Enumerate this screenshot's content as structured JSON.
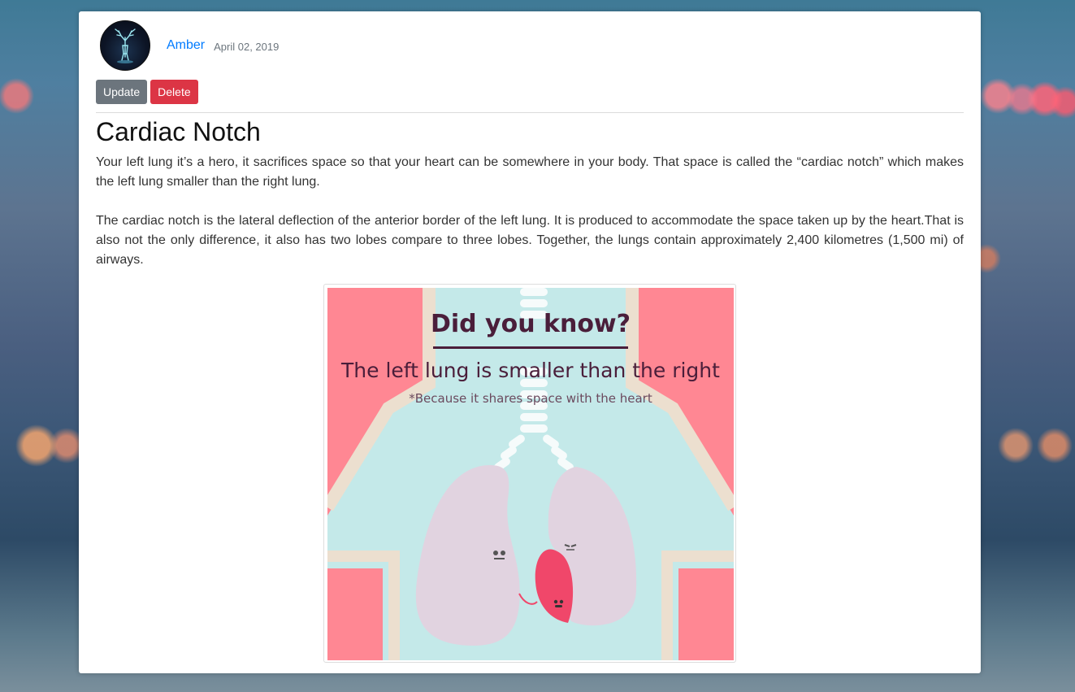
{
  "post": {
    "author": "Amber",
    "date": "April 02, 2019",
    "title": "Cardiac Notch",
    "paragraphs": [
      "Your left lung it’s a hero, it sacrifices space so that your heart can be somewhere in your body. That space is called the “cardiac notch” which makes the left lung smaller than the right lung.",
      "The cardiac notch is the lateral deflection of the anterior border of the left lung. It is produced to accommodate the space taken up by the heart.That is also not the only difference, it also has two lobes compare to three lobes. Together, the lungs contain approximately 2,400 kilometres (1,500 mi) of airways."
    ]
  },
  "actions": {
    "update_label": "Update",
    "delete_label": "Delete"
  },
  "illustration": {
    "heading": "Did you know?",
    "subheading": "The left lung is smaller than the right",
    "note": "*Because it shares space with the heart"
  },
  "colors": {
    "link": "#007bff",
    "button_secondary": "#6c757d",
    "button_danger": "#dc3545",
    "illustration_pink": "#ff8793",
    "illustration_teal": "#c4e9e9",
    "illustration_lung": "#e1d3e0",
    "illustration_heart": "#f0476a",
    "illustration_text": "#4a1e3a"
  }
}
